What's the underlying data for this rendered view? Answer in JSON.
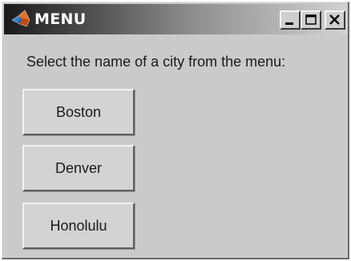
{
  "window": {
    "title": "MENU",
    "icon": "matlab-membrane-icon",
    "controls": {
      "minimize": "minimize-icon",
      "maximize": "maximize-icon",
      "close": "close-icon"
    }
  },
  "prompt": {
    "text": "Select the name of a city from the menu:"
  },
  "menu": {
    "items": [
      {
        "label": "Boston"
      },
      {
        "label": "Denver"
      },
      {
        "label": "Honolulu"
      }
    ]
  }
}
